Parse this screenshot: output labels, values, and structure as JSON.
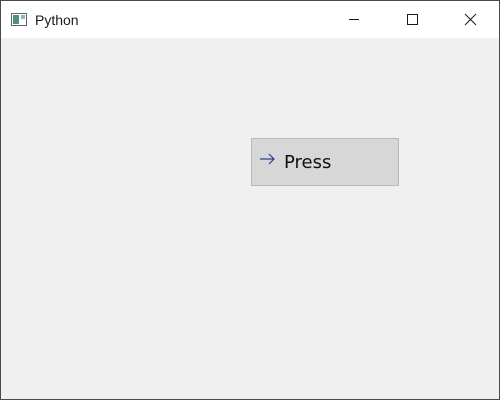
{
  "window": {
    "title": "Python",
    "app_icon": "python-app-icon",
    "caption_icons": [
      "minimize-icon",
      "maximize-icon",
      "close-icon"
    ]
  },
  "main": {
    "button": {
      "label": "Press",
      "icon": "arrow-right-icon",
      "icon_color": "#2b3a8f"
    }
  },
  "colors": {
    "titlebar": "#ffffff",
    "client_background": "#f0f0f0",
    "button_background": "#d7d7d7",
    "button_border": "#b9b9b9"
  }
}
